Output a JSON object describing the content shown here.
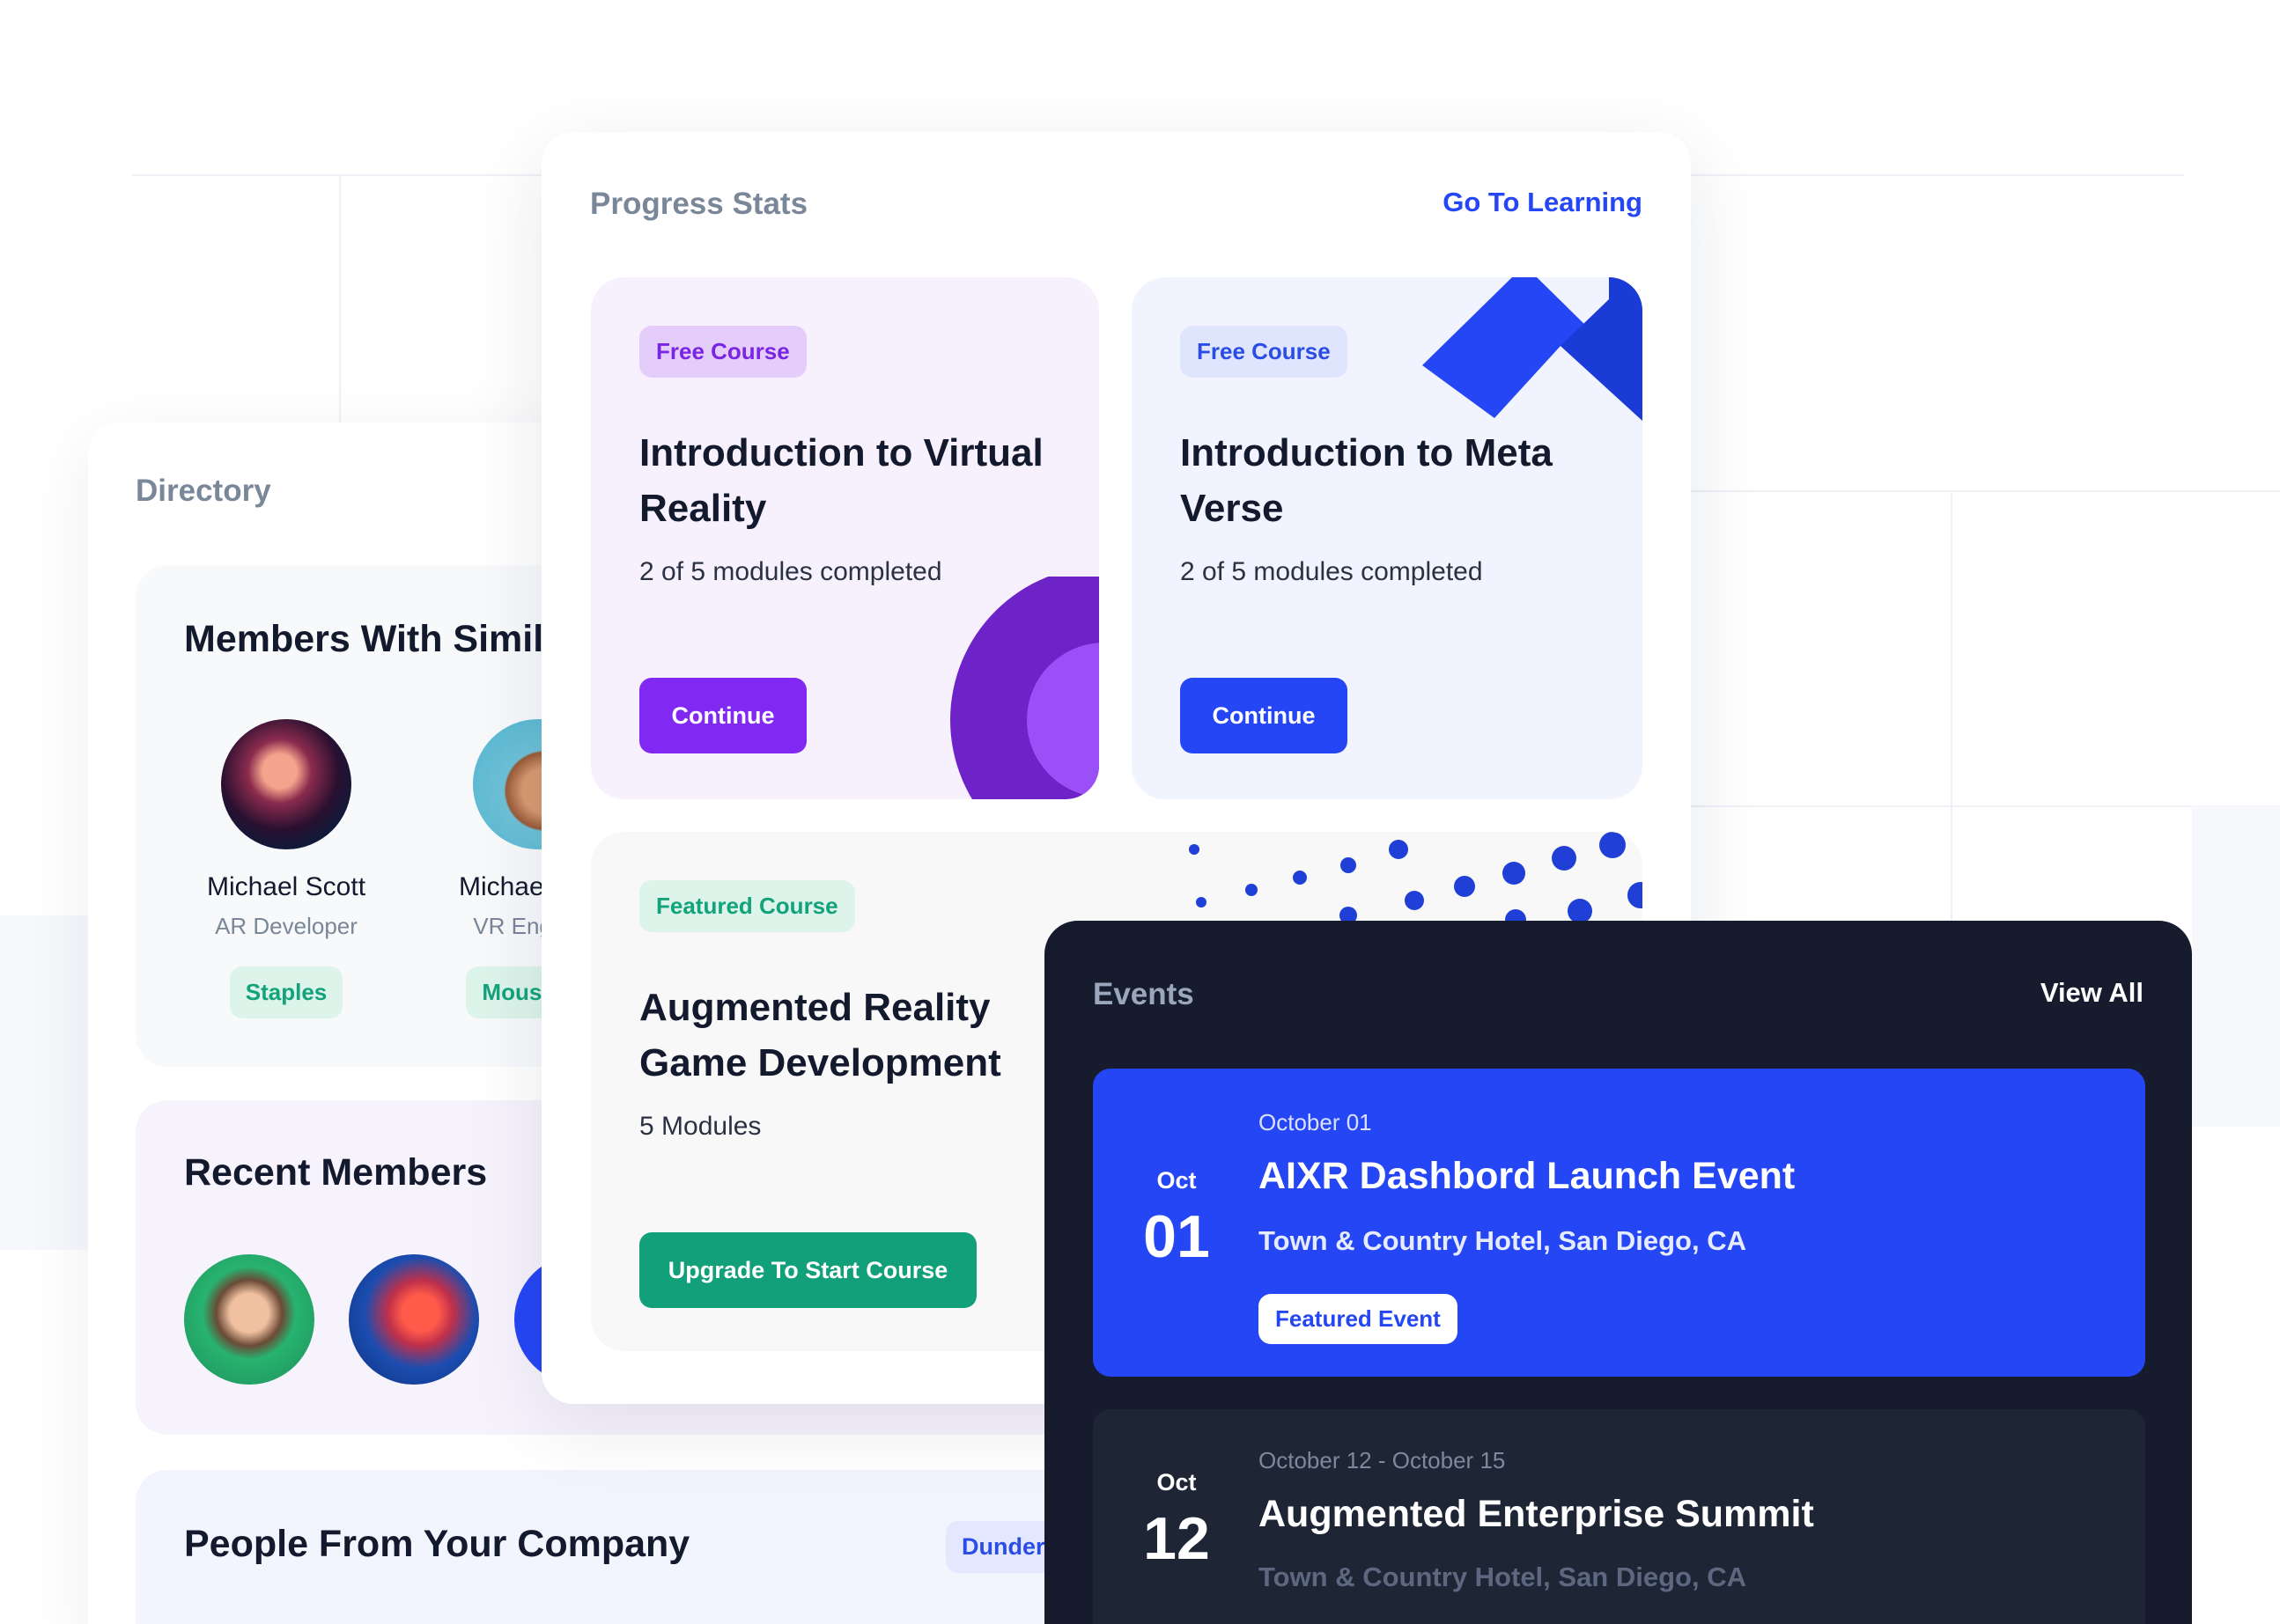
{
  "directory": {
    "title": "Directory",
    "similar": {
      "heading": "Members With Similar Interests",
      "members": [
        {
          "name": "Michael Scott",
          "role": "AR Developer",
          "company": "Staples"
        },
        {
          "name": "Michael Scott",
          "role": "VR Engineer",
          "company": "Mouse Inc"
        }
      ]
    },
    "recent": {
      "heading": "Recent Members"
    },
    "people": {
      "heading": "People From Your Company",
      "company_tag": "Dunder Mifflin"
    }
  },
  "progress": {
    "title": "Progress Stats",
    "link_label": "Go To Learning",
    "courses": [
      {
        "tag": "Free Course",
        "title": "Introduction to Virtual Reality",
        "meta": "2 of 5 modules completed",
        "button": "Continue"
      },
      {
        "tag": "Free Course",
        "title": "Introduction to Meta Verse",
        "meta": "2 of 5 modules completed",
        "button": "Continue"
      },
      {
        "tag": "Featured Course",
        "title": "Augmented Reality Game Development",
        "meta": "5 Modules",
        "button": "Upgrade To Start Course"
      }
    ]
  },
  "events": {
    "title": "Events",
    "view_all": "View All",
    "items": [
      {
        "month": "Oct",
        "day": "01",
        "date": "October 01",
        "name": "AIXR Dashbord Launch Event",
        "location": "Town & Country Hotel, San Diego, CA",
        "tag": "Featured Event"
      },
      {
        "month": "Oct",
        "day": "12",
        "date": "October 12 - October 15",
        "name": "Augmented Enterprise Summit",
        "location": "Town & Country Hotel, San Diego, CA"
      }
    ]
  },
  "colors": {
    "accent_blue": "#2546f5",
    "accent_purple": "#8128f2",
    "accent_green": "#12a07a",
    "dark_panel": "#161c2e"
  },
  "icons": [
    "avatar-photo",
    "ribbon-shape",
    "half-circle-shape",
    "dot-pattern"
  ]
}
